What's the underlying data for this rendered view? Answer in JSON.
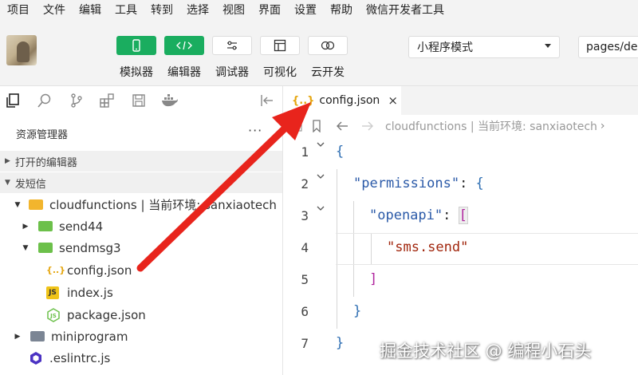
{
  "menu": [
    "项目",
    "文件",
    "编辑",
    "工具",
    "转到",
    "选择",
    "视图",
    "界面",
    "设置",
    "帮助",
    "微信开发者工具"
  ],
  "toolbar": {
    "buttons": [
      {
        "label": "模拟器",
        "icon": "phone-icon",
        "active": true
      },
      {
        "label": "编辑器",
        "icon": "code-icon",
        "active": true
      },
      {
        "label": "调试器",
        "icon": "sliders-icon",
        "active": false
      },
      {
        "label": "可视化",
        "icon": "layout-icon",
        "active": false
      },
      {
        "label": "云开发",
        "icon": "cloud-icon",
        "active": false
      }
    ],
    "mode": "小程序模式",
    "page_path": "pages/der"
  },
  "sidebar": {
    "explorer_title": "资源管理器",
    "more": "···",
    "open_editors_label": "打开的编辑器",
    "project_label": "发短信",
    "tree": [
      {
        "label": "cloudfunctions | 当前环境: sanxiaotech",
        "type": "folder-cloud"
      },
      {
        "label": "send44",
        "type": "folder-green"
      },
      {
        "label": "sendmsg3",
        "type": "folder-green"
      },
      {
        "label": "config.json",
        "type": "json"
      },
      {
        "label": "index.js",
        "type": "js"
      },
      {
        "label": "package.json",
        "type": "node"
      },
      {
        "label": "miniprogram",
        "type": "folder-grey"
      },
      {
        "label": ".eslintrc.js",
        "type": "eslint"
      }
    ]
  },
  "editor": {
    "tab_label": "config.json",
    "tab_icon": "{..}",
    "close": "×",
    "breadcrumb": "cloudfunctions | 当前环境: sanxiaotech",
    "lines": [
      {
        "n": "1",
        "code": "{"
      },
      {
        "n": "2",
        "code": "\"permissions\": {"
      },
      {
        "n": "3",
        "code": "\"openapi\": ["
      },
      {
        "n": "4",
        "code": "\"sms.send\""
      },
      {
        "n": "5",
        "code": "]"
      },
      {
        "n": "6",
        "code": "}"
      },
      {
        "n": "7",
        "code": "}"
      }
    ]
  },
  "watermark": "掘金技术社区 @ 编程小石头",
  "colors": {
    "green": "#1aad5f",
    "arrow": "#e8241c",
    "brace": "#2f6fb3",
    "bracket": "#b0259e",
    "string": "#a1260d"
  }
}
